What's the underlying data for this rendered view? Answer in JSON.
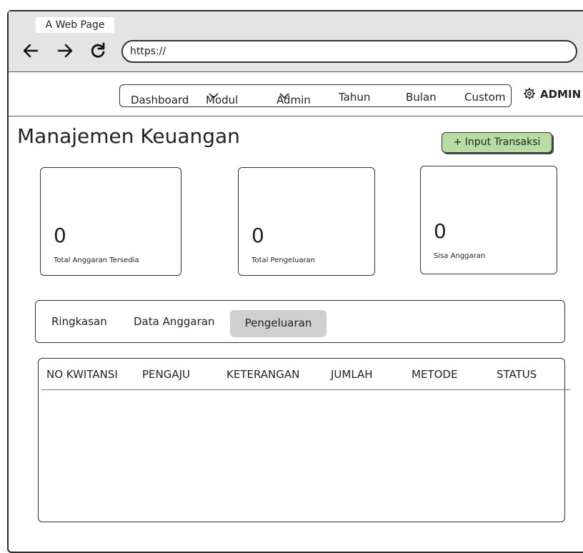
{
  "browser": {
    "tab_title": "A Web Page",
    "back_icon": "arrow-left-icon",
    "forward_icon": "arrow-right-icon",
    "reload_icon": "reload-icon",
    "url": "https://"
  },
  "nav": {
    "items": [
      {
        "label": "Dashboard",
        "has_dropdown": false
      },
      {
        "label": "Modul",
        "has_dropdown": true
      },
      {
        "label": "Admin",
        "has_dropdown": true
      },
      {
        "label": "Tahun",
        "has_dropdown": false
      },
      {
        "label": "Bulan",
        "has_dropdown": false
      },
      {
        "label": "Custom",
        "has_dropdown": false
      }
    ],
    "chevron": "⌄",
    "settings_icon": "gear-icon",
    "user_label": "ADMIN"
  },
  "page": {
    "title": "Manajemen Keuangan",
    "input_button": "+ Input Transaksi",
    "input_button_color": "#b9dca3"
  },
  "cards": [
    {
      "value": "0",
      "label": "Total Anggaran Tersedia"
    },
    {
      "value": "0",
      "label": "Total Pengeluaran"
    },
    {
      "value": "0",
      "label": "Sisa Anggaran"
    }
  ],
  "tabs": {
    "items": [
      "Ringkasan",
      "Data Anggaran",
      "Pengeluaran"
    ],
    "active": "Pengeluaran"
  },
  "table": {
    "columns": [
      "NO KWITANSI",
      "PENGAJU",
      "KETERANGAN",
      "JUMLAH",
      "METODE",
      "STATUS"
    ],
    "rows": []
  }
}
